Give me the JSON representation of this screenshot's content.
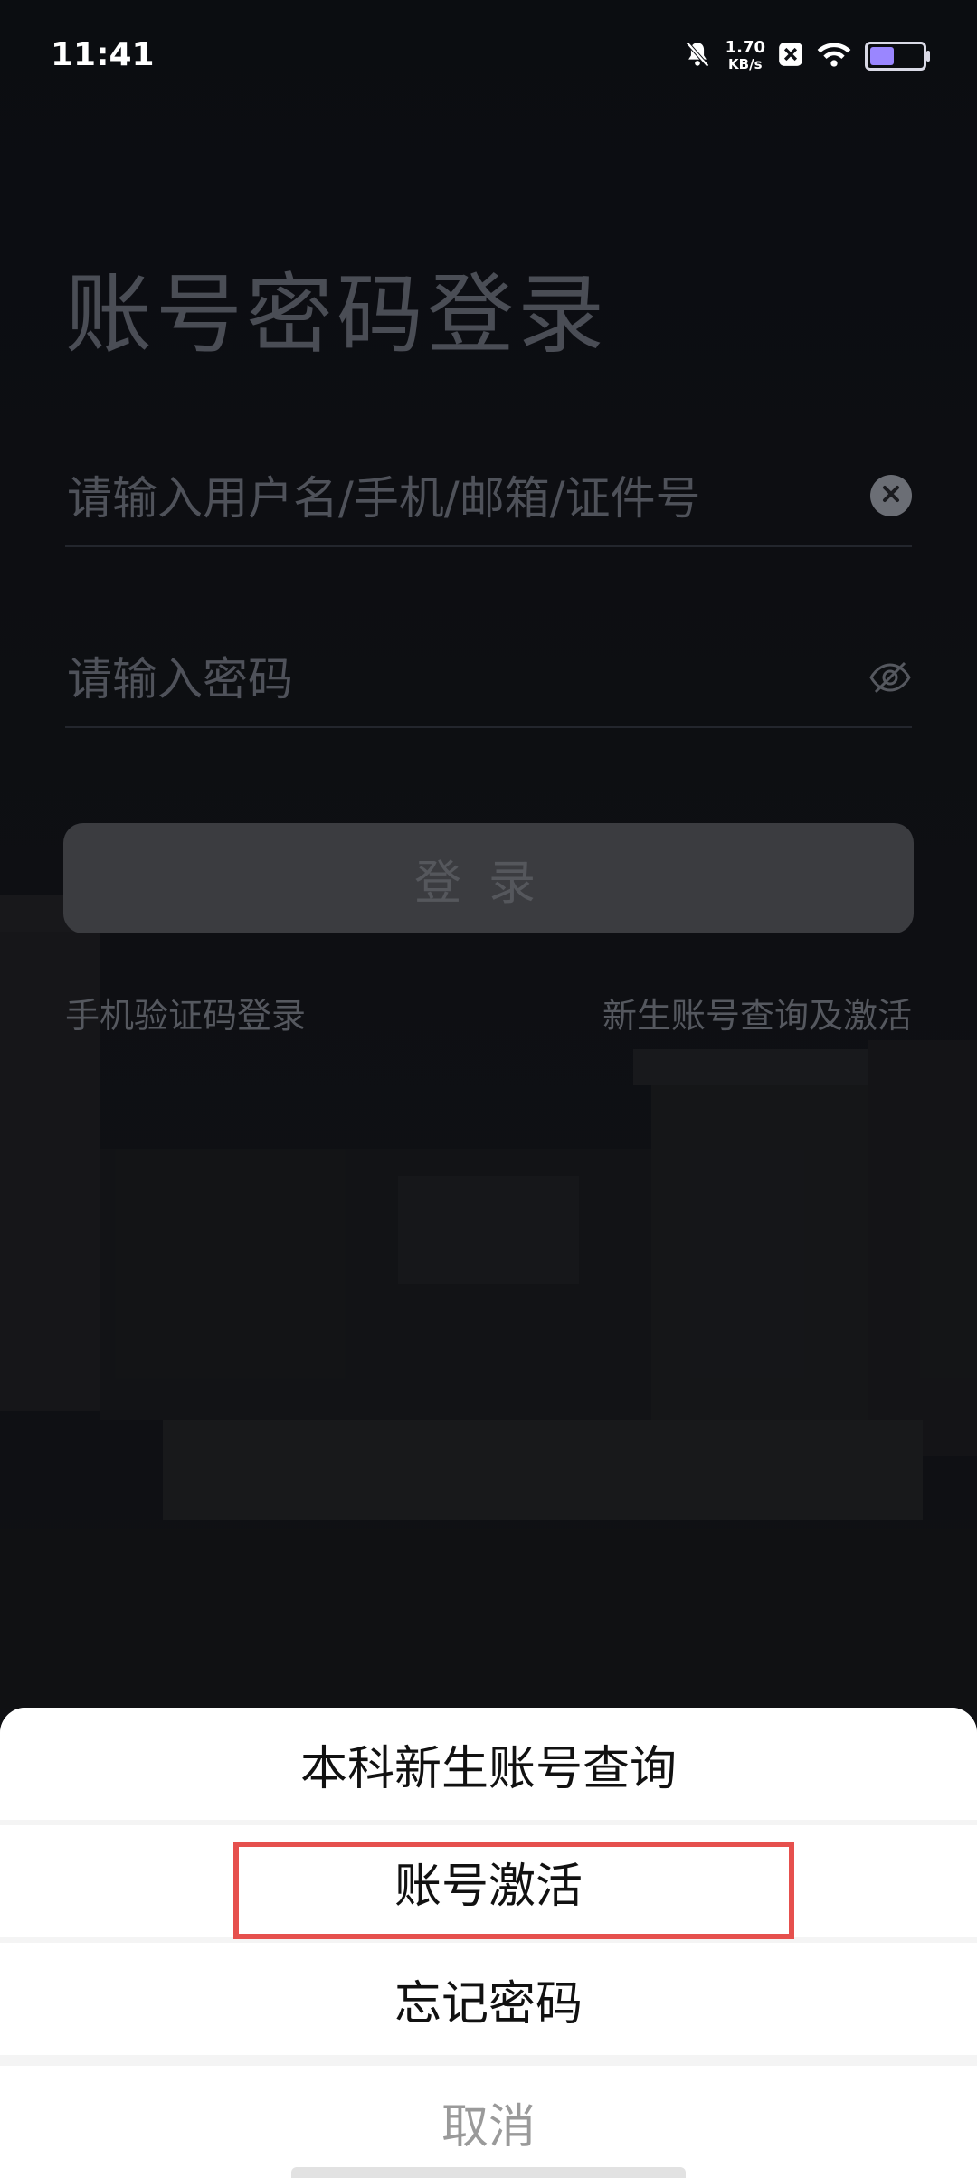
{
  "status_bar": {
    "time": "11:41",
    "net_speed_value": "1.70",
    "net_speed_unit": "KB/s",
    "icons": [
      "bell-muted-icon",
      "x-app-icon",
      "wifi-icon",
      "battery-icon"
    ]
  },
  "page": {
    "title": "账号密码登录",
    "username_placeholder": "请输入用户名/手机/邮箱/证件号",
    "password_placeholder": "请输入密码",
    "login_label": "登录",
    "sms_login_link": "手机验证码登录",
    "freshman_link": "新生账号查询及激活"
  },
  "action_sheet": {
    "items": [
      {
        "label": "本科新生账号查询"
      },
      {
        "label": "账号激活"
      },
      {
        "label": "忘记密码"
      }
    ],
    "cancel_label": "取消"
  },
  "colors": {
    "highlight": "#e6504d",
    "battery_fill": "#9a86ff"
  }
}
